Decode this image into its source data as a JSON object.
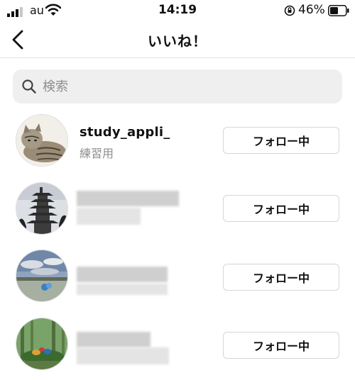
{
  "status_bar": {
    "carrier": "au",
    "time": "14:19",
    "battery": "46%"
  },
  "header": {
    "title": "いいね！",
    "back_icon": "chevron-left-icon"
  },
  "search": {
    "placeholder": "検索",
    "value": "",
    "icon": "search-icon"
  },
  "users": [
    {
      "username": "study_appli_",
      "fullname": "練習用",
      "follow_label": "フォロー中"
    },
    {
      "username": "",
      "fullname": "",
      "follow_label": "フォロー中"
    },
    {
      "username": "",
      "fullname": "",
      "follow_label": "フォロー中"
    },
    {
      "username": "",
      "fullname": "",
      "follow_label": "フォロー中"
    }
  ]
}
